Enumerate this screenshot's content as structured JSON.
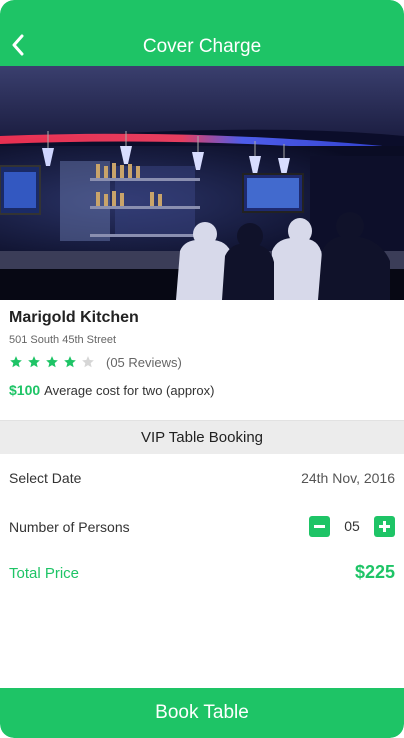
{
  "header": {
    "title": "Cover Charge",
    "back_icon": "chevron-left-icon"
  },
  "hero": {
    "alt_icon": "restaurant-bar-photo"
  },
  "venue": {
    "name": "Marigold Kitchen",
    "address": "501 South 45th Street",
    "rating": 4,
    "rating_max": 5,
    "reviews_text": "(05 Reviews)",
    "cost_value": "$100",
    "cost_text": "Average cost for two (approx)"
  },
  "booking": {
    "section_title": "VIP Table Booking",
    "date_label": "Select Date",
    "date_value": "24th Nov, 2016",
    "persons_label": "Number of Persons",
    "persons_value": "05",
    "total_label": "Total Price",
    "total_value": "$225"
  },
  "footer": {
    "book_label": "Book Table"
  },
  "colors": {
    "accent": "#1ec466",
    "star_empty": "#d6d6d6",
    "section_bg": "#ececec"
  }
}
